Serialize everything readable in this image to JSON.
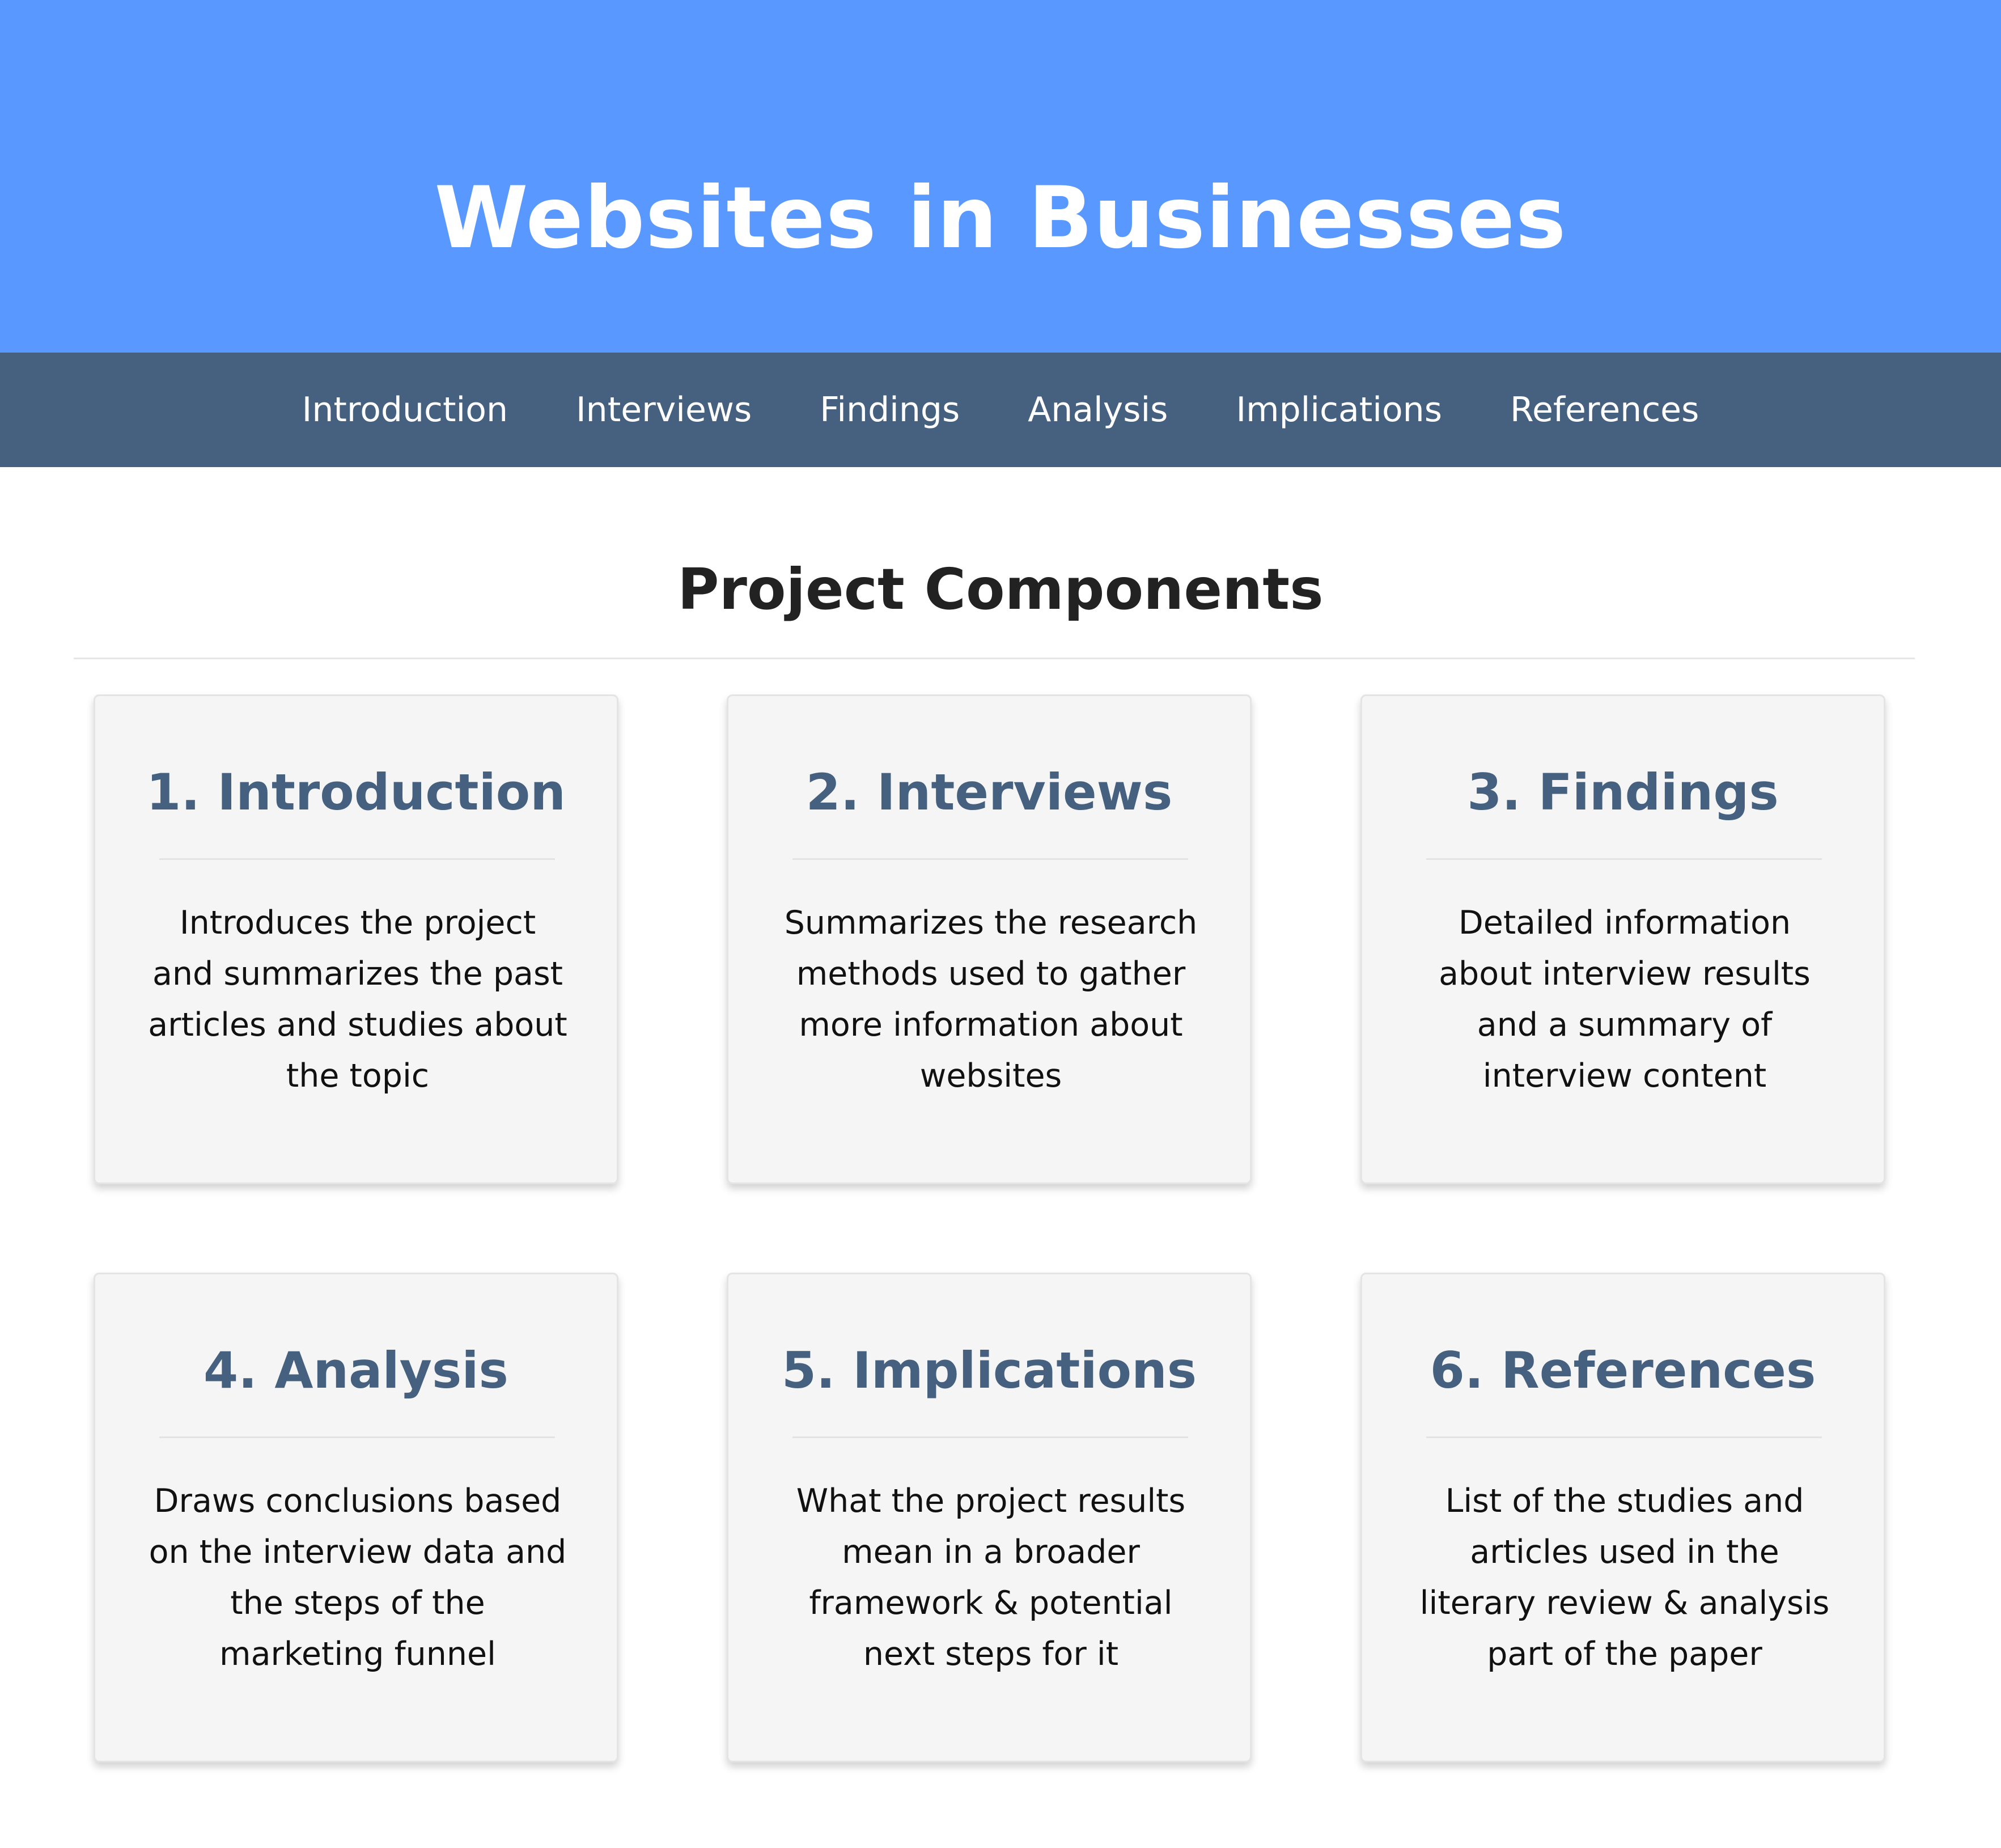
{
  "header": {
    "title": "Websites in Businesses",
    "background_color": "#5998ff"
  },
  "nav": {
    "background_color": "#45617f",
    "items": [
      {
        "label": "Introduction"
      },
      {
        "label": "Interviews"
      },
      {
        "label": "Findings"
      },
      {
        "label": "Analysis"
      },
      {
        "label": "Implications"
      },
      {
        "label": "References"
      }
    ]
  },
  "main": {
    "section_title": "Project Components",
    "cards": [
      {
        "title": "1. Introduction",
        "description": "Introduces the project and summarizes the past articles and studies about the topic"
      },
      {
        "title": "2. Interviews",
        "description": "Summarizes the research methods used to gather more information about websites"
      },
      {
        "title": "3. Findings",
        "description": "Detailed information about interview results and a summary of interview content"
      },
      {
        "title": "4. Analysis",
        "description": "Draws conclusions based on the interview data and the steps of the marketing funnel"
      },
      {
        "title": "5. Implications",
        "description": "What the project results mean in a broader framework & potential next steps for it"
      },
      {
        "title": "6. References",
        "description": "List of the studies and articles used in the literary review & analysis part of the paper"
      }
    ],
    "card_title_color": "#45617f"
  }
}
